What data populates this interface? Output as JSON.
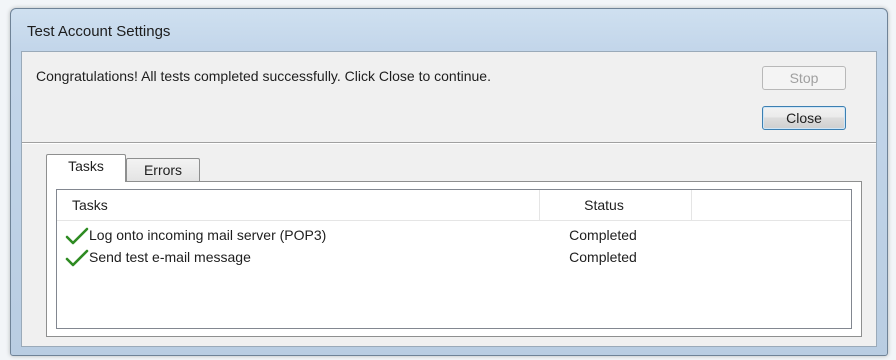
{
  "window": {
    "title": "Test Account Settings"
  },
  "message": "Congratulations! All tests completed successfully. Click Close to continue.",
  "buttons": {
    "stop_label": "Stop",
    "close_label": "Close"
  },
  "tabs": [
    {
      "label": "Tasks",
      "selected": true
    },
    {
      "label": "Errors",
      "selected": false
    }
  ],
  "table": {
    "columns": [
      "Tasks",
      "Status"
    ],
    "rows": [
      {
        "icon": "checkmark-icon",
        "task": "Log onto incoming mail server (POP3)",
        "status": "Completed"
      },
      {
        "icon": "checkmark-icon",
        "task": "Send test e-mail message",
        "status": "Completed"
      }
    ]
  },
  "colors": {
    "check": "#2e8b22",
    "title_bar": "#c3d6ea"
  }
}
